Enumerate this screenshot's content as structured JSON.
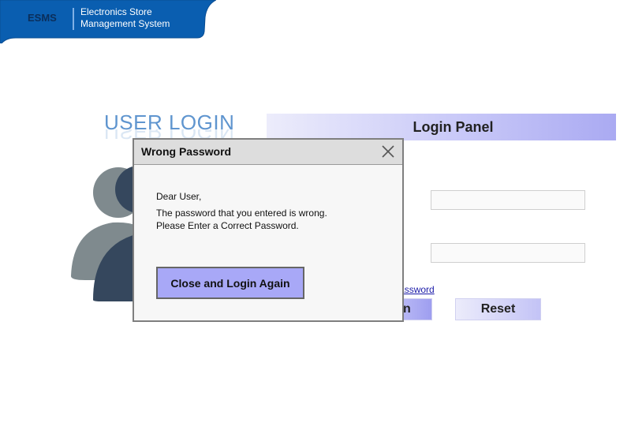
{
  "header": {
    "abbr": "ESMS",
    "name_line1": "Electronics Store",
    "name_line2": "Management System",
    "color": "#0a5eb0"
  },
  "login": {
    "heading": "USER LOGIN",
    "panel_title": "Login Panel",
    "username_value": "",
    "password_value": "",
    "forgot_link": "Forgot Password",
    "login_button": "Login",
    "reset_button": "Reset"
  },
  "modal": {
    "title": "Wrong Password",
    "greeting": "Dear User,",
    "message_line1": "The password that you entered is wrong.",
    "message_line2": "Please Enter a Correct Password.",
    "button_label": "Close and Login Again",
    "close_icon": "close-icon"
  }
}
